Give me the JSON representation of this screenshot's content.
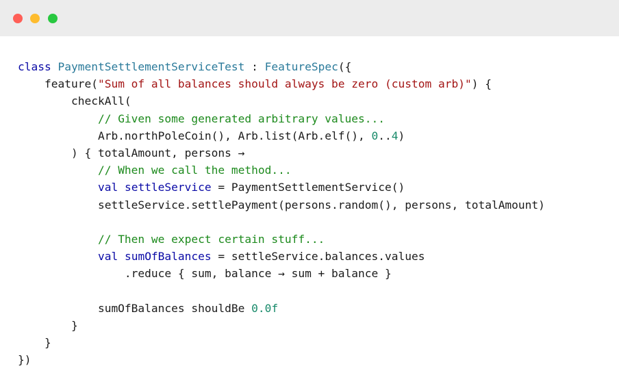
{
  "window": {
    "traffic_lights": [
      {
        "name": "close",
        "color": "#ff5f57"
      },
      {
        "name": "minimize",
        "color": "#febc2e"
      },
      {
        "name": "zoom",
        "color": "#28c840"
      }
    ]
  },
  "code": {
    "lines": [
      [
        {
          "t": "class",
          "k": "keyword"
        },
        {
          "t": " ",
          "k": "plain"
        },
        {
          "t": "PaymentSettlementServiceTest",
          "k": "type"
        },
        {
          "t": " : ",
          "k": "plain"
        },
        {
          "t": "FeatureSpec",
          "k": "type"
        },
        {
          "t": "({",
          "k": "plain"
        }
      ],
      [
        {
          "t": "    feature(",
          "k": "plain"
        },
        {
          "t": "\"Sum of all balances should always be zero (custom arb)\"",
          "k": "string"
        },
        {
          "t": ") {",
          "k": "plain"
        }
      ],
      [
        {
          "t": "        checkAll(",
          "k": "plain"
        }
      ],
      [
        {
          "t": "            ",
          "k": "plain"
        },
        {
          "t": "// Given some generated arbitrary values...",
          "k": "comment"
        }
      ],
      [
        {
          "t": "            Arb.northPoleCoin(), Arb.list(Arb.elf(), ",
          "k": "plain"
        },
        {
          "t": "0",
          "k": "number"
        },
        {
          "t": "..",
          "k": "plain"
        },
        {
          "t": "4",
          "k": "number"
        },
        {
          "t": ")",
          "k": "plain"
        }
      ],
      [
        {
          "t": "        ) { totalAmount, persons →",
          "k": "plain"
        }
      ],
      [
        {
          "t": "            ",
          "k": "plain"
        },
        {
          "t": "// When we call the method...",
          "k": "comment"
        }
      ],
      [
        {
          "t": "            ",
          "k": "plain"
        },
        {
          "t": "val",
          "k": "keyword"
        },
        {
          "t": " ",
          "k": "plain"
        },
        {
          "t": "settleService",
          "k": "decl"
        },
        {
          "t": " = PaymentSettlementService()",
          "k": "plain"
        }
      ],
      [
        {
          "t": "            settleService.settlePayment(persons.random(), persons, totalAmount)",
          "k": "plain"
        }
      ],
      [
        {
          "t": "",
          "k": "plain"
        }
      ],
      [
        {
          "t": "            ",
          "k": "plain"
        },
        {
          "t": "// Then we expect certain stuff...",
          "k": "comment"
        }
      ],
      [
        {
          "t": "            ",
          "k": "plain"
        },
        {
          "t": "val",
          "k": "keyword"
        },
        {
          "t": " ",
          "k": "plain"
        },
        {
          "t": "sumOfBalances",
          "k": "decl"
        },
        {
          "t": " = settleService.balances.values",
          "k": "plain"
        }
      ],
      [
        {
          "t": "                .reduce { sum, balance → sum + balance }",
          "k": "plain"
        }
      ],
      [
        {
          "t": "",
          "k": "plain"
        }
      ],
      [
        {
          "t": "            sumOfBalances shouldBe ",
          "k": "plain"
        },
        {
          "t": "0.0f",
          "k": "number"
        }
      ],
      [
        {
          "t": "        }",
          "k": "plain"
        }
      ],
      [
        {
          "t": "    }",
          "k": "plain"
        }
      ],
      [
        {
          "t": "})",
          "k": "plain"
        }
      ]
    ]
  }
}
